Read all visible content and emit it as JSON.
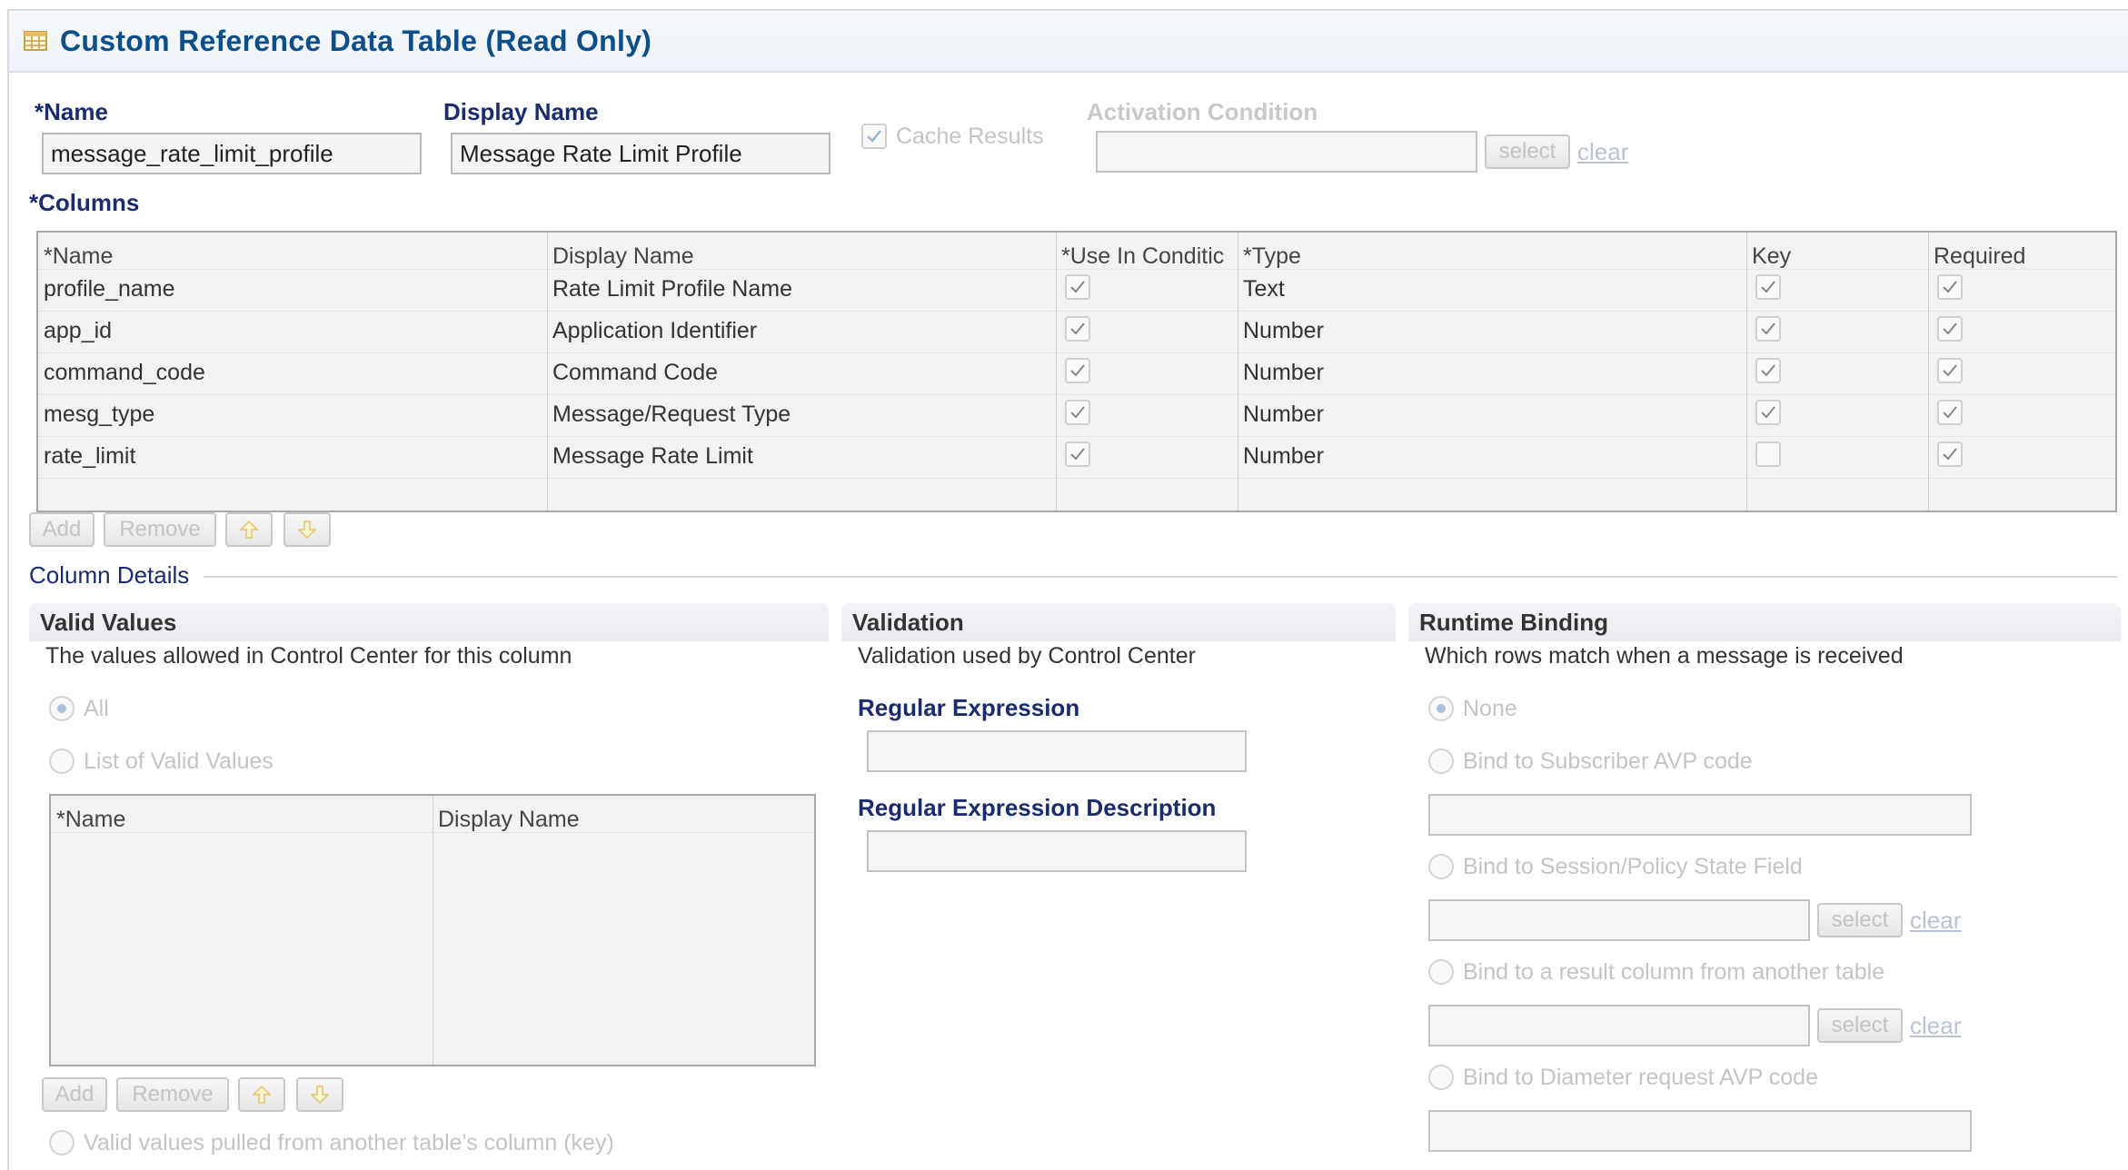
{
  "title": "Custom Reference Data Table (Read Only)",
  "fields": {
    "name_label": "*Name",
    "name_value": "message_rate_limit_profile",
    "display_name_label": "Display Name",
    "display_name_value": "Message Rate Limit Profile",
    "cache_results_label": "Cache Results",
    "activation_label": "Activation Condition",
    "select_label": "select",
    "clear_label": "clear"
  },
  "columns": {
    "label": "*Columns",
    "headers": [
      "*Name",
      "Display Name",
      "*Use In Conditic",
      "*Type",
      "Key",
      "Required"
    ],
    "rows": [
      {
        "name": "profile_name",
        "display": "Rate Limit Profile Name",
        "use": true,
        "type": "Text",
        "key": true,
        "required": true
      },
      {
        "name": "app_id",
        "display": "Application Identifier",
        "use": true,
        "type": "Number",
        "key": true,
        "required": true
      },
      {
        "name": "command_code",
        "display": "Command Code",
        "use": true,
        "type": "Number",
        "key": true,
        "required": true
      },
      {
        "name": "mesg_type",
        "display": "Message/Request Type",
        "use": true,
        "type": "Number",
        "key": true,
        "required": true
      },
      {
        "name": "rate_limit",
        "display": "Message Rate Limit",
        "use": true,
        "type": "Number",
        "key": false,
        "required": true
      }
    ],
    "add_label": "Add",
    "remove_label": "Remove"
  },
  "column_details": {
    "title": "Column Details",
    "valid_values": {
      "title": "Valid Values",
      "desc": "The values allowed in Control Center for this column",
      "opt_all": "All",
      "opt_list": "List of Valid Values",
      "grid_headers": [
        "*Name",
        "Display Name"
      ],
      "add_label": "Add",
      "remove_label": "Remove",
      "opt_pulled": "Valid values pulled from another table's column (key)"
    },
    "validation": {
      "title": "Validation",
      "desc": "Validation used by Control Center",
      "regex_label": "Regular Expression",
      "regex_desc_label": "Regular Expression Description"
    },
    "runtime": {
      "title": "Runtime Binding",
      "desc": "Which rows match when a message is received",
      "opt_none": "None",
      "opt_subscriber": "Bind to Subscriber AVP code",
      "opt_session": "Bind to Session/Policy State Field",
      "opt_result": "Bind to a result column from another table",
      "opt_diameter": "Bind to Diameter request AVP code",
      "select_label": "select",
      "clear_label": "clear"
    }
  },
  "icons": {
    "table": "table-icon",
    "check": "checkmark-icon",
    "up": "arrow-up-icon",
    "down": "arrow-down-icon"
  }
}
